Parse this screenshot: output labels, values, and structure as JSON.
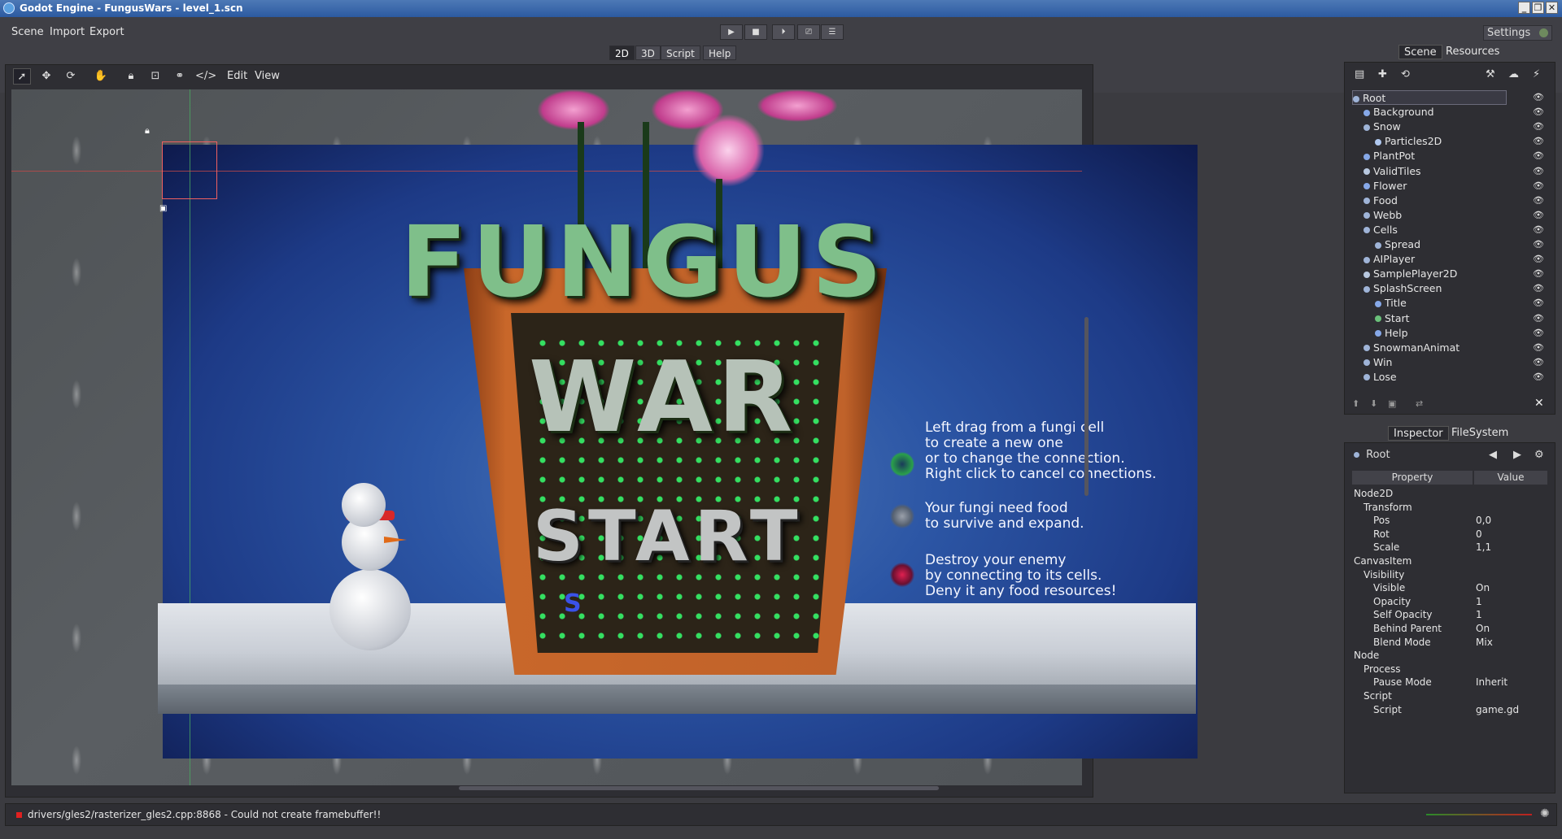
{
  "window": {
    "title": "Godot Engine - FungusWars - level_1.scn"
  },
  "menu": {
    "scene": "Scene",
    "import": "Import",
    "export": "Export",
    "settings": "Settings"
  },
  "playback": {
    "play": "▶",
    "stop": "■",
    "pause": "⏵",
    "scene_play": "⎚",
    "custom": "☰"
  },
  "main_tabs": {
    "t2d": "2D",
    "t3d": "3D",
    "script": "Script",
    "help": "Help"
  },
  "toolbar": {
    "edit": "Edit",
    "view": "View"
  },
  "game": {
    "title_word_1": "FUNGUS",
    "title_word_2": "WAR",
    "start_word": "START",
    "help_1": [
      "Left drag from a fungi cell",
      "to create a new one",
      "or to change the connection.",
      "Right click to cancel connections."
    ],
    "help_2": [
      "Your fungi need food",
      "to survive and expand."
    ],
    "help_3": [
      "Destroy your enemy",
      "by connecting to its cells.",
      "Deny it any food resources!"
    ],
    "marker": "S"
  },
  "right_tabs": {
    "scene": "Scene",
    "resources": "Resources",
    "inspector": "Inspector",
    "filesystem": "FileSystem"
  },
  "scene_tree": [
    {
      "label": "Root",
      "indent": 0,
      "selected": true
    },
    {
      "label": "Background",
      "indent": 1
    },
    {
      "label": "Snow",
      "indent": 1
    },
    {
      "label": "Particles2D",
      "indent": 2
    },
    {
      "label": "PlantPot",
      "indent": 1
    },
    {
      "label": "ValidTiles",
      "indent": 1
    },
    {
      "label": "Flower",
      "indent": 1
    },
    {
      "label": "Food",
      "indent": 1
    },
    {
      "label": "Webb",
      "indent": 1
    },
    {
      "label": "Cells",
      "indent": 1
    },
    {
      "label": "Spread",
      "indent": 2
    },
    {
      "label": "AIPlayer",
      "indent": 1
    },
    {
      "label": "SamplePlayer2D",
      "indent": 1
    },
    {
      "label": "SplashScreen",
      "indent": 1
    },
    {
      "label": "Title",
      "indent": 2
    },
    {
      "label": "Start",
      "indent": 2
    },
    {
      "label": "Help",
      "indent": 2
    },
    {
      "label": "SnowmanAnimat",
      "indent": 1
    },
    {
      "label": "Win",
      "indent": 1
    },
    {
      "label": "Lose",
      "indent": 1
    }
  ],
  "inspector": {
    "node": "Root",
    "col_property": "Property",
    "col_value": "Value",
    "sections": [
      {
        "label": "Node2D",
        "level": 0
      },
      {
        "label": "Transform",
        "level": 1
      },
      {
        "label": "Pos",
        "value": "0,0",
        "level": 2
      },
      {
        "label": "Rot",
        "value": "0",
        "level": 2
      },
      {
        "label": "Scale",
        "value": "1,1",
        "level": 2
      },
      {
        "label": "CanvasItem",
        "level": 0
      },
      {
        "label": "Visibility",
        "level": 1
      },
      {
        "label": "Visible",
        "value": "On",
        "level": 2
      },
      {
        "label": "Opacity",
        "value": "1",
        "level": 2
      },
      {
        "label": "Self Opacity",
        "value": "1",
        "level": 2
      },
      {
        "label": "Behind Parent",
        "value": "On",
        "level": 2
      },
      {
        "label": "Blend Mode",
        "value": "Mix",
        "level": 2
      },
      {
        "label": "Node",
        "level": 0
      },
      {
        "label": "Process",
        "level": 1
      },
      {
        "label": "Pause Mode",
        "value": "Inherit",
        "level": 2
      },
      {
        "label": "Script",
        "level": 1
      },
      {
        "label": "Script",
        "value": "game.gd",
        "level": 2
      }
    ]
  },
  "status": {
    "message": "drivers/gles2/rasterizer_gles2.cpp:8868 - Could not create framebuffer!!"
  }
}
